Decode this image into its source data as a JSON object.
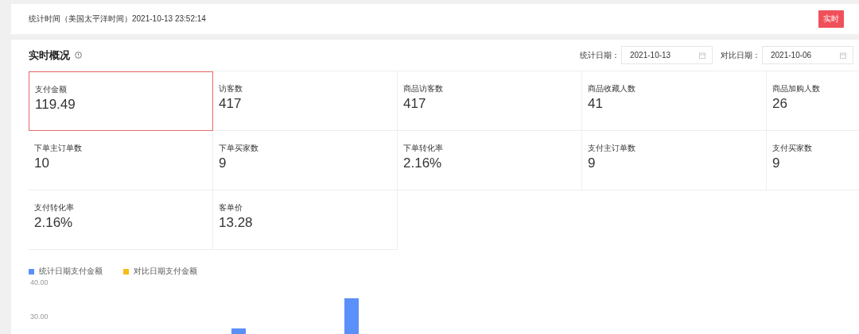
{
  "stat_time": {
    "text": "统计时间（美国太平洋时间）2021-10-13 23:52:14",
    "badge": "实时"
  },
  "overview": {
    "title": "实时概况",
    "date_fields": [
      {
        "label": "统计日期：",
        "value": "2021-10-13"
      },
      {
        "label": "对比日期：",
        "value": "2021-10-06"
      }
    ],
    "metrics": [
      {
        "label": "支付金额",
        "value": "119.49",
        "selected": true
      },
      {
        "label": "访客数",
        "value": "417",
        "selected": false
      },
      {
        "label": "商品访客数",
        "value": "417",
        "selected": false
      },
      {
        "label": "商品收藏人数",
        "value": "41",
        "selected": false
      },
      {
        "label": "商品加购人数",
        "value": "26",
        "selected": false
      },
      {
        "label": "下单主订单数",
        "value": "10",
        "selected": false
      },
      {
        "label": "下单买家数",
        "value": "9",
        "selected": false
      },
      {
        "label": "下单转化率",
        "value": "2.16%",
        "selected": false
      },
      {
        "label": "支付主订单数",
        "value": "9",
        "selected": false
      },
      {
        "label": "支付买家数",
        "value": "9",
        "selected": false
      },
      {
        "label": "支付转化率",
        "value": "2.16%",
        "selected": false
      },
      {
        "label": "客单价",
        "value": "13.28",
        "selected": false
      }
    ]
  },
  "chart": {
    "legend": [
      {
        "label": "统计日期支付金额",
        "color": "#5b8ff9"
      },
      {
        "label": "对比日期支付金额",
        "color": "#f6bd16"
      }
    ],
    "axis_labels": [
      "40.00",
      "30.00"
    ]
  }
}
